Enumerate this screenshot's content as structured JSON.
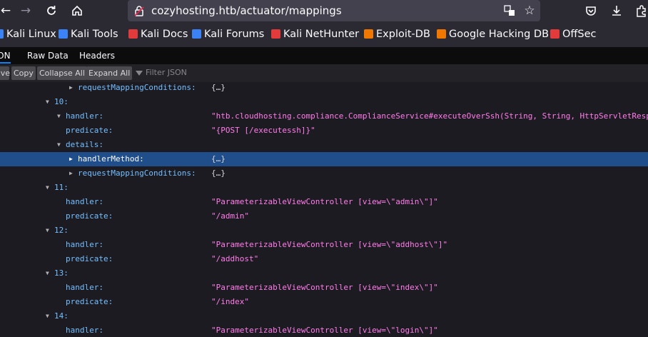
{
  "browser": {
    "url": "cozyhosting.htb/actuator/mappings",
    "nav_icons": [
      "back-icon",
      "forward-icon",
      "reload-icon",
      "home-icon",
      "lock-icon",
      "translate-icon",
      "star-icon",
      "pocket-icon",
      "download-icon",
      "extensions-icon"
    ]
  },
  "bookmarks": [
    {
      "label": "Kali Linux",
      "color": "#3b82f6"
    },
    {
      "label": "Kali Tools",
      "color": "#3b82f6"
    },
    {
      "label": "Kali Docs",
      "color": "#e33b3b"
    },
    {
      "label": "Kali Forums",
      "color": "#3b82f6"
    },
    {
      "label": "Kali NetHunter",
      "color": "#e33b3b"
    },
    {
      "label": "Exploit-DB",
      "color": "#f07800"
    },
    {
      "label": "Google Hacking DB",
      "color": "#f07800"
    },
    {
      "label": "OffSec",
      "color": "#e33b3b"
    }
  ],
  "viewer_tabs": [
    {
      "label": "JSON",
      "active": true
    },
    {
      "label": "Raw Data",
      "active": false
    },
    {
      "label": "Headers",
      "active": false
    }
  ],
  "toolbar": {
    "save_label": "Save",
    "copy_label": "Copy",
    "collapse_label": "Collapse All",
    "expand_label": "Expand All",
    "filter_placeholder": "Filter JSON"
  },
  "rows": [
    {
      "level": 4,
      "key": "requestMappingConditions:",
      "value": "{…}",
      "type": "obj",
      "twisty": "right"
    },
    {
      "level": 2,
      "key": "10:",
      "value": "",
      "type": "",
      "twisty": "down"
    },
    {
      "level": 3,
      "key": "handler:",
      "value": "\"htb.cloudhosting.compliance.ComplianceService#executeOverSsh(String, String, HttpServletRespo",
      "type": "str",
      "twisty": "down"
    },
    {
      "level": 3,
      "key": "predicate:",
      "value": "\"{POST [/executessh]}\"",
      "type": "str",
      "twisty": ""
    },
    {
      "level": 3,
      "key": "details:",
      "value": "",
      "type": "",
      "twisty": "down"
    },
    {
      "level": 4,
      "key": "handlerMethod:",
      "value": "{…}",
      "type": "obj",
      "twisty": "right",
      "selected": true
    },
    {
      "level": 4,
      "key": "requestMappingConditions:",
      "value": "{…}",
      "type": "obj",
      "twisty": "right"
    },
    {
      "level": 2,
      "key": "11:",
      "value": "",
      "type": "",
      "twisty": "down"
    },
    {
      "level": 3,
      "key": "handler:",
      "value": "\"ParameterizableViewController [view=\\\"admin\\\"]\"",
      "type": "str",
      "twisty": ""
    },
    {
      "level": 3,
      "key": "predicate:",
      "value": "\"/admin\"",
      "type": "str",
      "twisty": ""
    },
    {
      "level": 2,
      "key": "12:",
      "value": "",
      "type": "",
      "twisty": "down"
    },
    {
      "level": 3,
      "key": "handler:",
      "value": "\"ParameterizableViewController [view=\\\"addhost\\\"]\"",
      "type": "str",
      "twisty": ""
    },
    {
      "level": 3,
      "key": "predicate:",
      "value": "\"/addhost\"",
      "type": "str",
      "twisty": ""
    },
    {
      "level": 2,
      "key": "13:",
      "value": "",
      "type": "",
      "twisty": "down"
    },
    {
      "level": 3,
      "key": "handler:",
      "value": "\"ParameterizableViewController [view=\\\"index\\\"]\"",
      "type": "str",
      "twisty": ""
    },
    {
      "level": 3,
      "key": "predicate:",
      "value": "\"/index\"",
      "type": "str",
      "twisty": ""
    },
    {
      "level": 2,
      "key": "14:",
      "value": "",
      "type": "",
      "twisty": "down"
    },
    {
      "level": 3,
      "key": "handler:",
      "value": "\"ParameterizableViewController [view=\\\"login\\\"]\"",
      "type": "str",
      "twisty": ""
    }
  ]
}
